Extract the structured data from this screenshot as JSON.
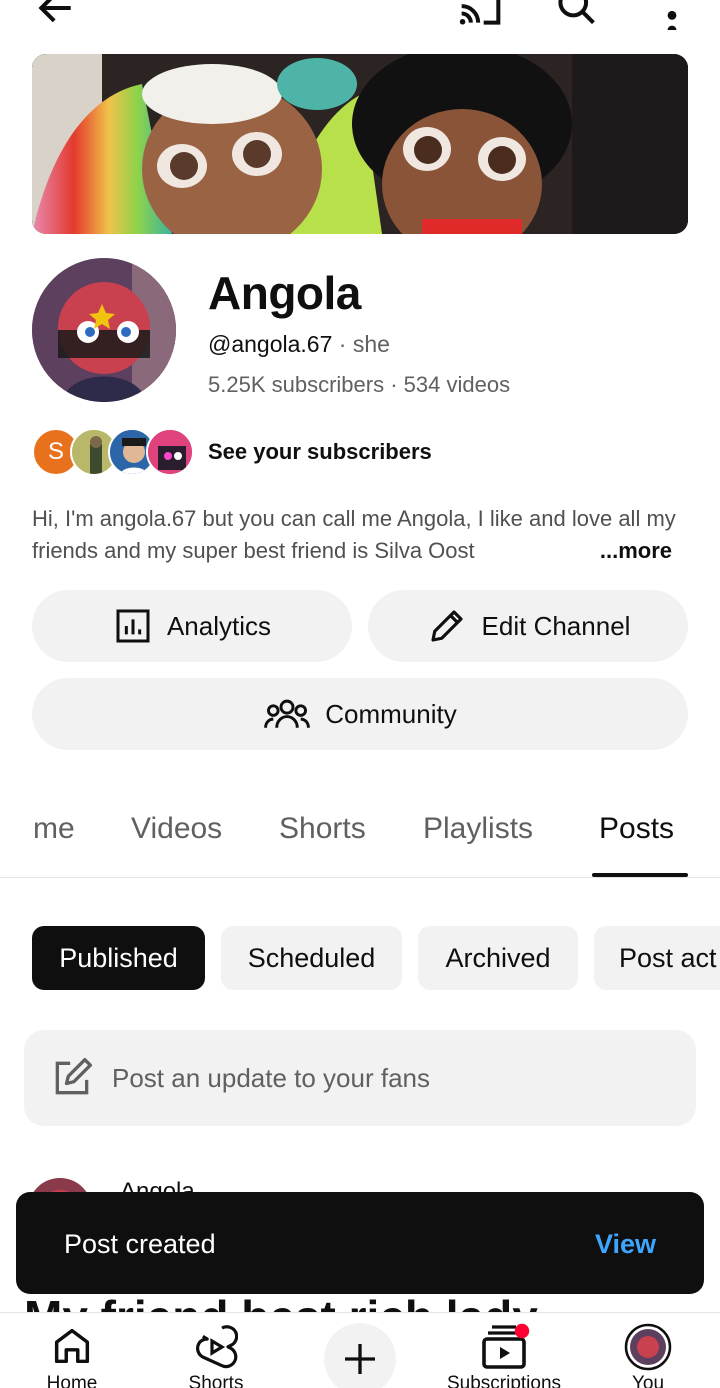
{
  "topbar": {
    "back_icon": "arrow-left-icon",
    "cast_icon": "cast-icon",
    "search_icon": "search-icon",
    "more_icon": "more-vert-icon"
  },
  "channel": {
    "name": "Angola",
    "handle": "@angola.67",
    "pronoun": "she",
    "subscribers": "5.25K subscribers",
    "videos": "534 videos",
    "subs_link": "See your subscribers",
    "sub_initial": "S",
    "description": "Hi, I'm angola.67 but you can call me Angola, I like and love all my friends and my super best friend is Silva Oost",
    "more": "...more"
  },
  "actions": {
    "analytics": "Analytics",
    "edit": "Edit Channel",
    "community": "Community"
  },
  "tabs": [
    {
      "label": "me"
    },
    {
      "label": "Videos"
    },
    {
      "label": "Shorts"
    },
    {
      "label": "Playlists"
    },
    {
      "label": "Posts"
    }
  ],
  "active_tab": "Posts",
  "chips": [
    {
      "label": "Published"
    },
    {
      "label": "Scheduled"
    },
    {
      "label": "Archived"
    },
    {
      "label": "Post act"
    }
  ],
  "post_box": {
    "placeholder": "Post an update to your fans"
  },
  "feed_peek": {
    "author": "Angola",
    "text": "My friend best rich lady"
  },
  "toast": {
    "message": "Post created",
    "action": "View"
  },
  "nav": [
    {
      "label": "Home"
    },
    {
      "label": "Shorts"
    },
    {
      "label": "Subscriptions"
    },
    {
      "label": "You"
    }
  ],
  "colors": {
    "accent_link": "#3ea6ff",
    "notification_dot": "#ff0033",
    "chip_active": "#0f0f0f"
  }
}
